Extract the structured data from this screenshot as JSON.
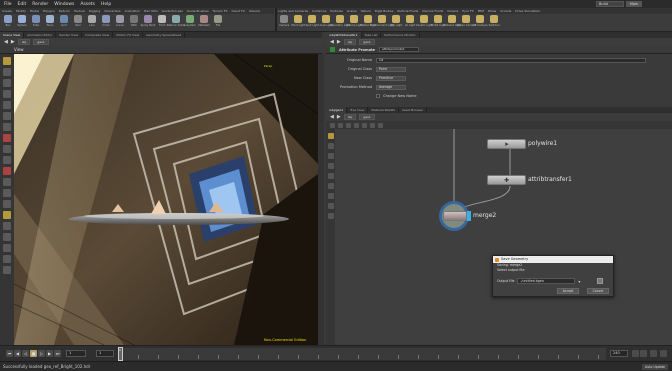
{
  "menubar": {
    "items": [
      "File",
      "Edit",
      "Render",
      "Windows",
      "Assets",
      "Help"
    ],
    "build": "Build",
    "main": "Main"
  },
  "shelf": {
    "tabs": [
      "Create",
      "Modify",
      "Model",
      "Polygon",
      "Deform",
      "Texture",
      "Rigging",
      "Characters",
      "Animation",
      "Hair Utils",
      "Guide Process",
      "Guide Brushes",
      "Terrain FX",
      "Cloud FX",
      "Volume"
    ],
    "tools": [
      "Box",
      "Sphere",
      "Tube",
      "Torus",
      "Grid",
      "Null",
      "Line",
      "Circle",
      "Curve",
      "Path",
      "Spray Paint",
      "Font",
      "Platonic Solids",
      "L-System",
      "Metaball",
      "File"
    ],
    "light_tabs": [
      "Lights and Cameras",
      "Collisions",
      "Particles",
      "Grains",
      "Vellum",
      "Rigid Bodies",
      "Particle Fluids",
      "Viscous Fluids",
      "Oceans",
      "Pyro FX",
      "FEM",
      "Wires",
      "Crowds",
      "Drive Simulation"
    ],
    "light_tools": [
      "Camera",
      "Point Light",
      "Spot Light",
      "Area Light",
      "Geometry Light",
      "Volume Light",
      "Distant Light",
      "Environment Light",
      "Sky Light",
      "GI Light",
      "Caustic Light",
      "Portal Light",
      "Ambient Light",
      "Stereo Camera",
      "VR Camera",
      "Switcher"
    ]
  },
  "left_tabs": [
    "Scene View",
    "Animation Editor",
    "Render View",
    "Composite View",
    "Motion FX View",
    "Geometry Spreadsheet"
  ],
  "left_path": [
    "obj",
    "geo1"
  ],
  "view_title": "View",
  "scene_label": "Persp",
  "nav_label": "Non-Commercial Edition",
  "right_top": {
    "tabs": [
      "/obj/attribtransfer1",
      "Take List",
      "Performance Monitor"
    ],
    "path": [
      "obj",
      "geo1"
    ],
    "param_type": "Attribute Promote",
    "param_name": "attribpromote1",
    "params": [
      {
        "label": "Original Name",
        "value": "Cd"
      },
      {
        "label": "Original Class",
        "value": "Point"
      },
      {
        "label": "New Class",
        "value": "Primitive"
      },
      {
        "label": "Promotion Method",
        "value": "Average"
      },
      {
        "label": "Change New Name",
        "value": ""
      }
    ]
  },
  "right_bottom": {
    "tabs": [
      "/obj/geo1",
      "Tree View",
      "Material Palette",
      "Asset Browser"
    ],
    "path": [
      "obj",
      "geo1"
    ]
  },
  "network": {
    "nodes": [
      {
        "name": "polywire1"
      },
      {
        "name": "attribtransfer1"
      },
      {
        "name": "merge2"
      }
    ]
  },
  "dialog": {
    "title": "Save Geometry",
    "line1": "Saving: merge2",
    "line2": "Select output file:",
    "output_label": "Output File",
    "output_value": "./untitled.bgeo",
    "accept": "Accept",
    "cancel": "Cancel"
  },
  "timeline": {
    "current_frame": "1",
    "start_frame": "1",
    "end_frame": "240",
    "playhead_label": "1"
  },
  "statusbar": {
    "message": "Successfully loaded geo_ref_Bright_102.hdr",
    "auto_update": "Auto Update"
  },
  "colors": {
    "node_selected_ring": "#3a6aa8",
    "node_highlight": "#ffd24a",
    "viewport_label": "#e8e000"
  }
}
